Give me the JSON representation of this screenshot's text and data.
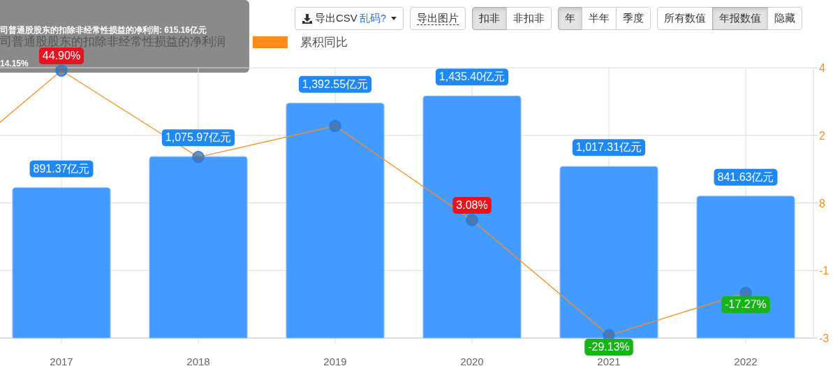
{
  "toolbar": {
    "export_csv": {
      "label": "导出CSV",
      "link": "乱码?"
    },
    "export_image": {
      "label": "导出图片"
    },
    "groups": [
      [
        {
          "label": "扣非",
          "selected": true
        },
        {
          "label": "非扣非",
          "selected": false
        }
      ],
      [
        {
          "label": "年",
          "selected": true
        },
        {
          "label": "半年",
          "selected": false
        },
        {
          "label": "季度",
          "selected": false
        }
      ],
      [
        {
          "label": "所有数值",
          "selected": false
        },
        {
          "label": "年报数值",
          "selected": true
        },
        {
          "label": "隐藏",
          "selected": false
        }
      ]
    ]
  },
  "chart_data": {
    "type": "bar",
    "grid": true,
    "ylim": [
      0,
      1602.5
    ],
    "categories": [
      "2017",
      "2018",
      "2019",
      "2020",
      "2021",
      "2022"
    ],
    "series": [
      {
        "name": "司普通股股东的扣除非经常性损益的净利润",
        "type": "bar",
        "color": "#3593ff",
        "values": [
          891.37,
          1075.97,
          1392.55,
          1435.4,
          1017.31,
          841.63
        ],
        "value_labels": [
          "891.37亿元",
          "1,075.97亿元",
          "1,392.55亿元",
          "1,435.40亿元",
          "1,017.31亿元",
          "841.63亿元"
        ]
      },
      {
        "name": "累积同比",
        "type": "line",
        "axis": "y2",
        "marker": true,
        "color": "#ff8c1a",
        "values": [
          44.9,
          20.71,
          29.42,
          3.08,
          -29.13,
          -17.27
        ],
        "value_labels": [
          "44.90%",
          null,
          null,
          "3.08%",
          "-29.13%",
          "-17.27%"
        ]
      }
    ]
  },
  "right_axis_labels": [
    "4",
    "2",
    "8",
    "-1",
    "-3"
  ],
  "tooltip": {
    "lines": [
      "司普通股股东的扣除非经常性损益的净利润: 615.16亿元",
      "14.15%"
    ]
  }
}
